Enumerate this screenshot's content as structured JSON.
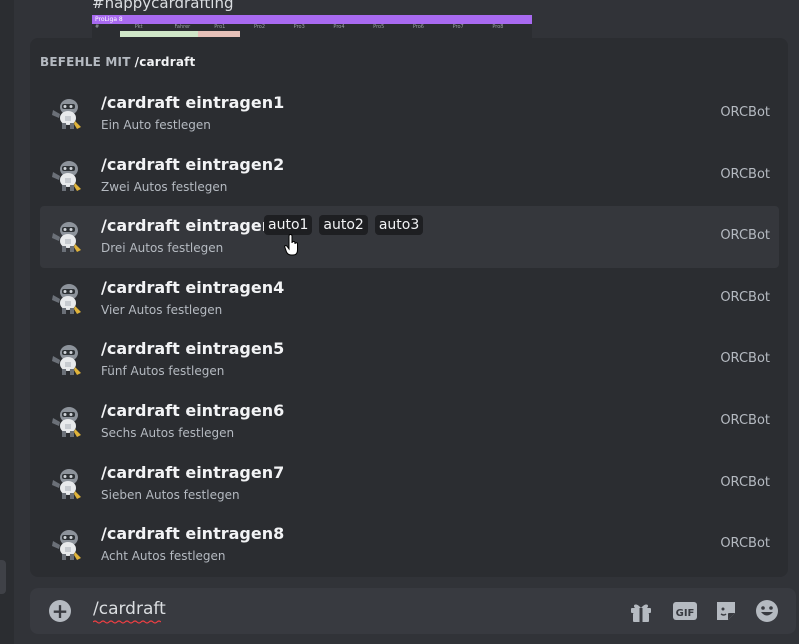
{
  "background_message": {
    "text": "#happycardrafting",
    "embed": {
      "title": "ProLiga 8",
      "columns": [
        "#",
        "Pkt",
        "Fahrer",
        "Pro1",
        "Pro2",
        "Pro3",
        "Pro4",
        "Pro5",
        "Pro6",
        "Pro7",
        "Pro8"
      ]
    }
  },
  "popup": {
    "header_prefix": "BEFEHLE MIT",
    "header_command": "/cardraft",
    "commands": [
      {
        "name": "/cardraft eintragen1",
        "description": "Ein Auto festlegen",
        "bot": "ORCBot"
      },
      {
        "name": "/cardraft eintragen2",
        "description": "Zwei Autos festlegen",
        "bot": "ORCBot"
      },
      {
        "name": "/cardraft eintragen3",
        "description": "Drei Autos festlegen",
        "bot": "ORCBot",
        "params": [
          "auto1",
          "auto2",
          "auto3"
        ]
      },
      {
        "name": "/cardraft eintragen4",
        "description": "Vier Autos festlegen",
        "bot": "ORCBot"
      },
      {
        "name": "/cardraft eintragen5",
        "description": "Fünf Autos festlegen",
        "bot": "ORCBot"
      },
      {
        "name": "/cardraft eintragen6",
        "description": "Sechs Autos festlegen",
        "bot": "ORCBot"
      },
      {
        "name": "/cardraft eintragen7",
        "description": "Sieben Autos festlegen",
        "bot": "ORCBot"
      },
      {
        "name": "/cardraft eintragen8",
        "description": "Acht Autos festlegen",
        "bot": "ORCBot"
      }
    ]
  },
  "input": {
    "value": "/cardraft",
    "buttons": {
      "plus": "+",
      "gift": "gift-icon",
      "gif": "GIF",
      "sticker": "sticker-icon",
      "emoji": "emoji-icon"
    }
  },
  "colors": {
    "accent_embed": "#a86af0",
    "spellcheck": "#f23f43"
  }
}
